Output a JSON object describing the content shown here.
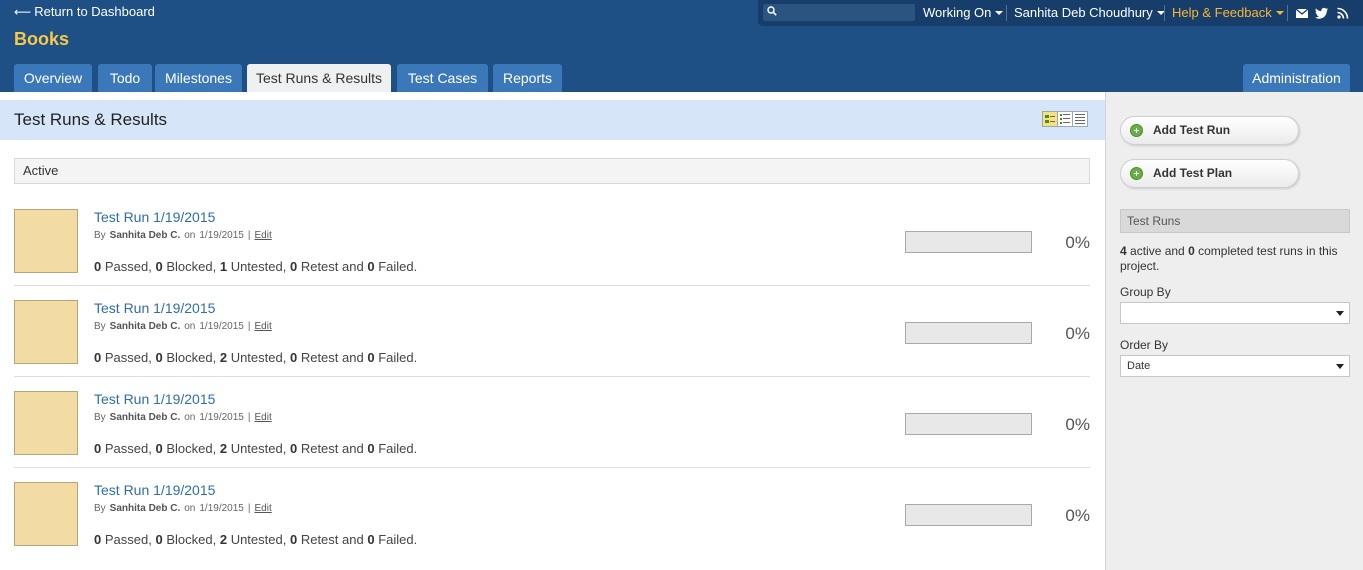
{
  "header": {
    "back_link": "Return to Dashboard",
    "project_title": "Books",
    "search_placeholder": "",
    "working_on": "Working On",
    "user_name": "Sanhita Deb Choudhury",
    "help": "Help & Feedback",
    "social_icons": [
      "mail-icon",
      "twitter-icon",
      "rss-icon"
    ]
  },
  "tabs": [
    {
      "label": "Overview",
      "active": false
    },
    {
      "label": "Todo",
      "active": false
    },
    {
      "label": "Milestones",
      "active": false
    },
    {
      "label": "Test Runs & Results",
      "active": true
    },
    {
      "label": "Test Cases",
      "active": false
    },
    {
      "label": "Reports",
      "active": false
    }
  ],
  "admin_tab": "Administration",
  "main": {
    "title": "Test Runs & Results",
    "group_label": "Active",
    "runs": [
      {
        "name": "Test Run 1/19/2015",
        "by_label": "By",
        "author": "Sanhita Deb C.",
        "on_label": "on",
        "date": "1/19/2015",
        "sep": "|",
        "edit": "Edit",
        "passed": "0",
        "blocked": "0",
        "untested": "1",
        "retest": "0",
        "failed": "0",
        "percent": "0%",
        "progress": 0
      },
      {
        "name": "Test Run 1/19/2015",
        "by_label": "By",
        "author": "Sanhita Deb C.",
        "on_label": "on",
        "date": "1/19/2015",
        "sep": "|",
        "edit": "Edit",
        "passed": "0",
        "blocked": "0",
        "untested": "2",
        "retest": "0",
        "failed": "0",
        "percent": "0%",
        "progress": 0
      },
      {
        "name": "Test Run 1/19/2015",
        "by_label": "By",
        "author": "Sanhita Deb C.",
        "on_label": "on",
        "date": "1/19/2015",
        "sep": "|",
        "edit": "Edit",
        "passed": "0",
        "blocked": "0",
        "untested": "2",
        "retest": "0",
        "failed": "0",
        "percent": "0%",
        "progress": 0
      },
      {
        "name": "Test Run 1/19/2015",
        "by_label": "By",
        "author": "Sanhita Deb C.",
        "on_label": "on",
        "date": "1/19/2015",
        "sep": "|",
        "edit": "Edit",
        "passed": "0",
        "blocked": "0",
        "untested": "2",
        "retest": "0",
        "failed": "0",
        "percent": "0%",
        "progress": 0
      }
    ],
    "stat_labels": {
      "passed": "Passed,",
      "blocked": "Blocked,",
      "untested": "Untested,",
      "retest": "Retest and",
      "failed": "Failed."
    }
  },
  "sidebar": {
    "add_test_run": "Add Test Run",
    "add_test_plan": "Add Test Plan",
    "section_title": "Test Runs",
    "summary": {
      "active_count": "4",
      "active_text": "active and",
      "completed_count": "0",
      "completed_text": "completed test runs in this project."
    },
    "group_by_label": "Group By",
    "group_by_value": "",
    "order_by_label": "Order By",
    "order_by_value": "Date"
  },
  "colors": {
    "header_bg": "#1e4f85",
    "tab_bg": "#3b78ba",
    "project_title": "#f7c949",
    "help_link": "#f7b733",
    "link": "#2f6eab",
    "title_bar": "#d6e6f8",
    "run_thumb": "#f3dca4"
  }
}
